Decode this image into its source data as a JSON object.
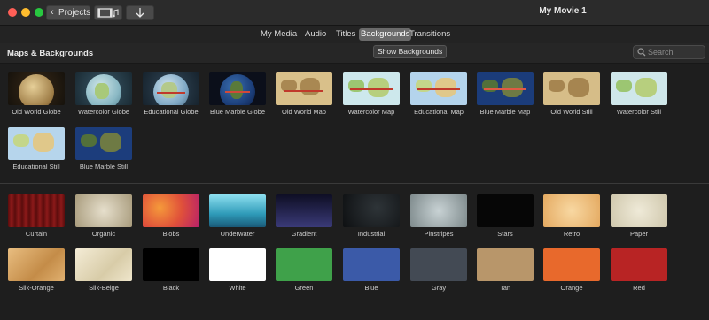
{
  "window": {
    "title": "My Movie 1",
    "traffic_lights": {
      "close": "#ff5f57",
      "minimize": "#febc2e",
      "zoom": "#28c840"
    },
    "projects_button": "Projects"
  },
  "tabs": [
    {
      "label": "My Media",
      "active": false
    },
    {
      "label": "Audio",
      "active": false
    },
    {
      "label": "Titles",
      "active": false
    },
    {
      "label": "Backgrounds",
      "active": true
    },
    {
      "label": "Transitions",
      "active": false
    }
  ],
  "header": {
    "title": "Maps & Backgrounds",
    "show_button": "Show Backgrounds",
    "search_placeholder": "Search"
  },
  "maps": [
    {
      "label": "Old World Globe",
      "style": "globe-old"
    },
    {
      "label": "Watercolor Globe",
      "style": "globe-water"
    },
    {
      "label": "Educational Globe",
      "style": "globe-edu"
    },
    {
      "label": "Blue Marble Globe",
      "style": "globe-blue"
    },
    {
      "label": "Old World Map",
      "style": "map-old"
    },
    {
      "label": "Watercolor Map",
      "style": "map-water"
    },
    {
      "label": "Educational Map",
      "style": "map-edu"
    },
    {
      "label": "Blue Marble Map",
      "style": "map-blue"
    },
    {
      "label": "Old World Still",
      "style": "still-old"
    },
    {
      "label": "Watercolor Still",
      "style": "still-water"
    },
    {
      "label": "Educational Still",
      "style": "still-edu"
    },
    {
      "label": "Blue Marble Still",
      "style": "still-blue"
    }
  ],
  "backgrounds": [
    {
      "label": "Curtain",
      "color": "#7a1414"
    },
    {
      "label": "Organic",
      "color": "#c9bfa8"
    },
    {
      "label": "Blobs",
      "color": "#e0513a"
    },
    {
      "label": "Underwater",
      "color": "#3aa6c4"
    },
    {
      "label": "Gradient",
      "color": "#22224a"
    },
    {
      "label": "Industrial",
      "color": "#15191c"
    },
    {
      "label": "Pinstripes",
      "color": "#a8b4b6"
    },
    {
      "label": "Stars",
      "color": "#0a0a0a"
    },
    {
      "label": "Retro",
      "color": "#f0c58a"
    },
    {
      "label": "Paper",
      "color": "#e4dfcc"
    },
    {
      "label": "Silk-Orange",
      "color": "#d9a868"
    },
    {
      "label": "Silk-Beige",
      "color": "#ebe2c8"
    },
    {
      "label": "Black",
      "color": "#000000"
    },
    {
      "label": "White",
      "color": "#ffffff"
    },
    {
      "label": "Green",
      "color": "#3fa14a"
    },
    {
      "label": "Blue",
      "color": "#3b5aa8"
    },
    {
      "label": "Gray",
      "color": "#434a54"
    },
    {
      "label": "Tan",
      "color": "#b8966a"
    },
    {
      "label": "Orange",
      "color": "#e8692c"
    },
    {
      "label": "Red",
      "color": "#b82424"
    }
  ]
}
